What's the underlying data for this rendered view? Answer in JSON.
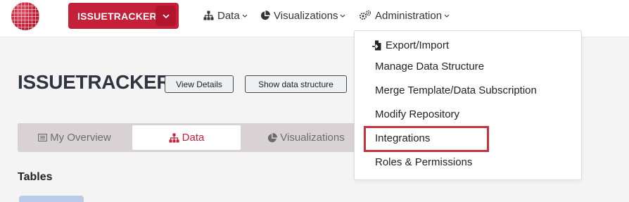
{
  "header": {
    "repo_button_label": "ISSUETRACKER",
    "nav": [
      {
        "label": "Data",
        "icon": "sitemap-icon"
      },
      {
        "label": "Visualizations",
        "icon": "pie-chart-icon"
      },
      {
        "label": "Administration",
        "icon": "gears-icon"
      }
    ]
  },
  "page": {
    "title": "ISSUETRACKER",
    "view_details_label": "View Details",
    "show_structure_label": "Show data structure"
  },
  "tabs": [
    {
      "label": "My Overview",
      "icon": "list-icon",
      "active": false
    },
    {
      "label": "Data",
      "icon": "sitemap-icon",
      "active": true
    },
    {
      "label": "Visualizations",
      "icon": "pie-chart-icon",
      "active": false
    }
  ],
  "section": {
    "tables_title": "Tables"
  },
  "admin_menu": {
    "items": [
      {
        "label": "Export/Import",
        "icon": "file-import-icon"
      },
      {
        "label": "Manage Data Structure"
      },
      {
        "label": "Merge Template/Data Subscription"
      },
      {
        "label": "Modify Repository"
      },
      {
        "label": "Integrations",
        "highlighted": true
      },
      {
        "label": "Roles & Permissions"
      }
    ]
  },
  "colors": {
    "brand": "#c51f3a",
    "highlight_border": "#c8313f"
  }
}
